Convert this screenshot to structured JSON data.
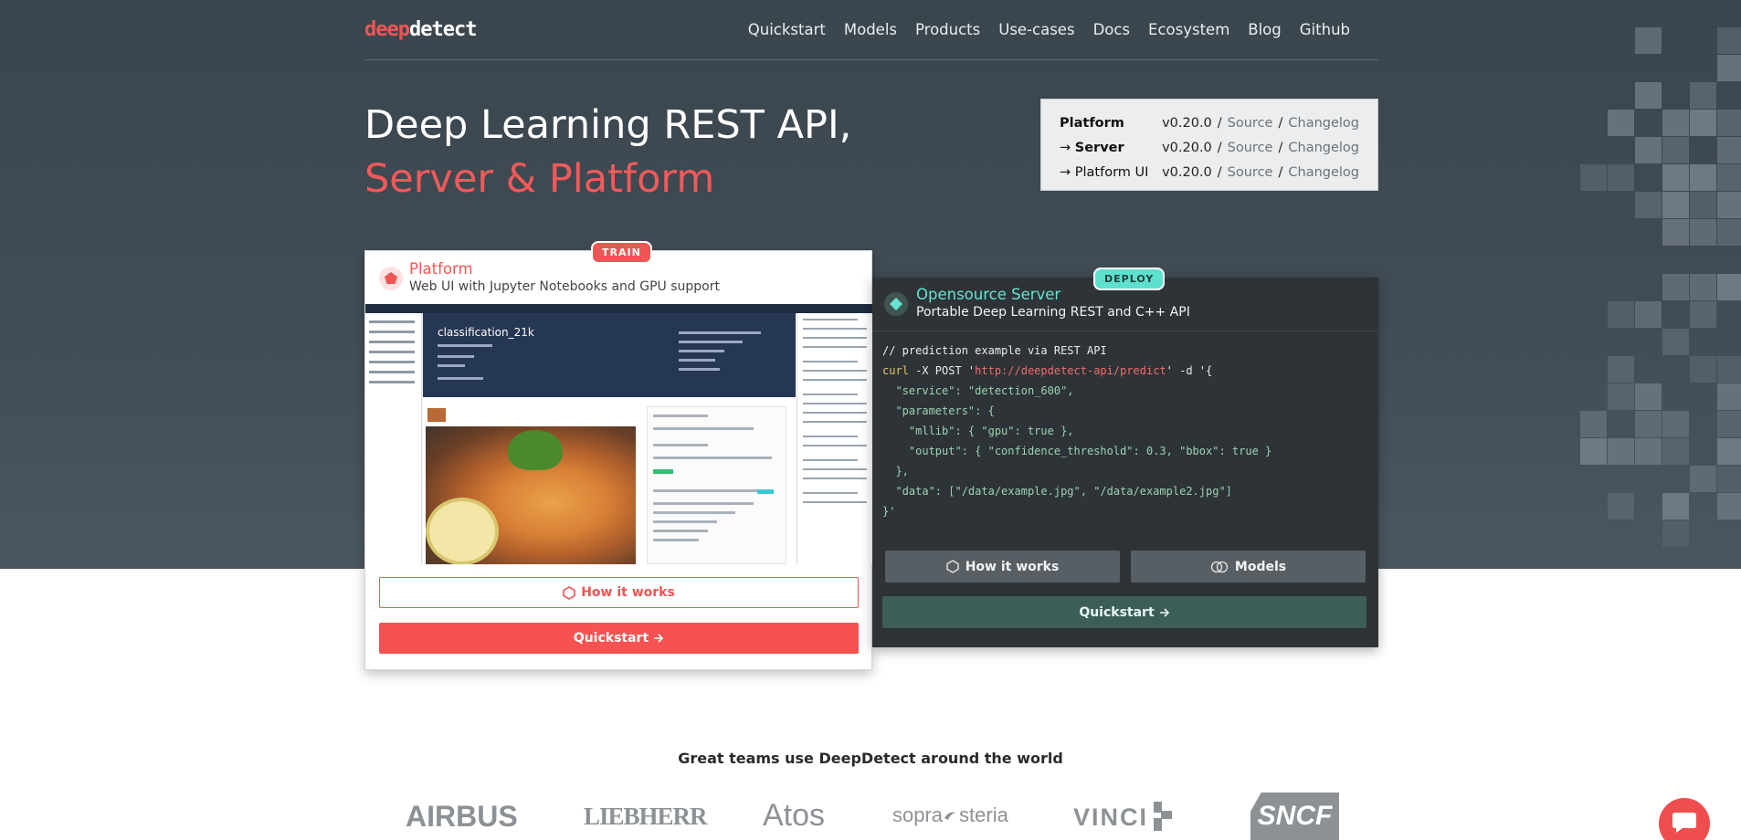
{
  "brand": {
    "logo_part1": "deep",
    "logo_part2": "detect"
  },
  "nav": {
    "items": [
      "Quickstart",
      "Models",
      "Products",
      "Use-cases",
      "Docs",
      "Ecosystem",
      "Blog",
      "Github"
    ]
  },
  "hero": {
    "line1": "Deep Learning REST API,",
    "line2": "Server & Platform"
  },
  "versions": {
    "rows": [
      {
        "prefix": "",
        "name": "Platform",
        "bold": true,
        "version": "v0.20.0",
        "source": "Source",
        "changelog": "Changelog"
      },
      {
        "prefix": "→",
        "name": "Server",
        "bold": true,
        "version": "v0.20.0",
        "source": "Source",
        "changelog": "Changelog"
      },
      {
        "prefix": "→",
        "name": "Platform UI",
        "bold": false,
        "version": "v0.20.0",
        "source": "Source",
        "changelog": "Changelog"
      }
    ],
    "separator": "/"
  },
  "platform_card": {
    "badge": "TRAIN",
    "title": "Platform",
    "subtitle": "Web UI with Jupyter Notebooks and GPU support",
    "screenshot": {
      "banner_title": "classification_21k"
    },
    "how_it_works": "How it works",
    "quickstart": "Quickstart"
  },
  "server_card": {
    "badge": "DEPLOY",
    "title": "Opensource Server",
    "subtitle": "Portable Deep Learning REST and C++ API",
    "code": {
      "comment": "// prediction example via REST API",
      "cmd": "curl",
      "args": " -X POST '",
      "url": "http://deepdetect-api/predict",
      "after_url": "' -d '{",
      "lines": [
        "  \"service\": \"detection_600\",",
        "  \"parameters\": {",
        "    \"mllib\": { \"gpu\": true },",
        "    \"output\": { \"confidence_threshold\": 0.3, \"bbox\": true }",
        "  },",
        "  \"data\": [\"/data/example.jpg\", \"/data/example2.jpg\"]",
        "}'"
      ]
    },
    "how_it_works": "How it works",
    "models": "Models",
    "quickstart": "Quickstart"
  },
  "teams": {
    "title": "Great teams use DeepDetect around the world",
    "logos": [
      "AIRBUS",
      "LIEBHERR",
      "Atos",
      "sopra",
      "steria",
      "VINCI",
      "SNCF"
    ]
  },
  "colors": {
    "accent_red": "#f05555",
    "accent_teal": "#5ee0cf",
    "hero_bg": "#414c55"
  }
}
